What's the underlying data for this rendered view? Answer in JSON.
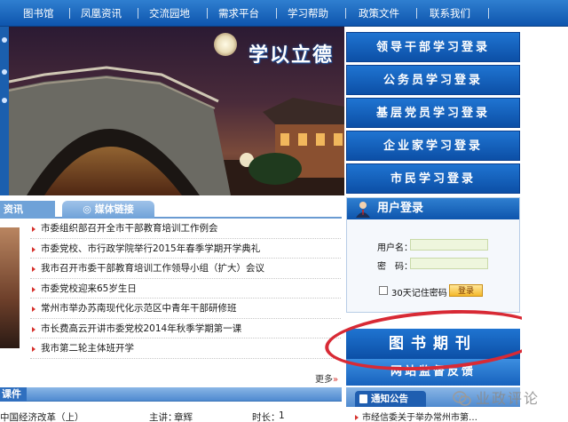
{
  "nav": {
    "items": [
      "图书馆",
      "凤凰资讯",
      "交流园地",
      "需求平台",
      "学习帮助",
      "政策文件",
      "联系我们"
    ]
  },
  "banner": {
    "title": "学以立德",
    "slide_numbers": [
      "1",
      "2",
      "3",
      "4"
    ]
  },
  "login_buttons": [
    "领导干部学习登录",
    "公务员学习登录",
    "基层党员学习登录",
    "企业家学习登录",
    "市民学习登录"
  ],
  "news": {
    "tabs": [
      "资讯",
      "媒体链接"
    ],
    "items": [
      "市委组织部召开全市干部教育培训工作例会",
      "市委党校、市行政学院举行2015年春季学期开学典礼",
      "我市召开市委干部教育培训工作领导小组（扩大）会议",
      "市委党校迎来65岁生日",
      "常州市举办苏南现代化示范区中青年干部研修班",
      "市长费高云开讲市委党校2014年秋季学期第一课",
      "我市第二轮主体班开学"
    ],
    "more": "更多",
    "more_arrow": "»"
  },
  "courses": {
    "title": "课件",
    "row": {
      "name": "中国经济改革（上）",
      "speaker_label": "主讲：",
      "speaker": "章辉",
      "duration_label": "时长：",
      "duration": "1"
    }
  },
  "user_login": {
    "title": "用户登录",
    "username_label": "用户名：",
    "password_label": "密　码：",
    "remember_label": "30天记住密码",
    "submit_label": "登录"
  },
  "books_button": "图书期刊",
  "supervise_button": "网站监督反馈",
  "notice": {
    "tab": "通知公告",
    "item": "市经信委关于举办常州市第…"
  },
  "watermark": "业政评论",
  "colors": {
    "nav_blue": "#0e55ad",
    "accent_red": "#d82a35",
    "button_blue": "#1f74d1"
  }
}
